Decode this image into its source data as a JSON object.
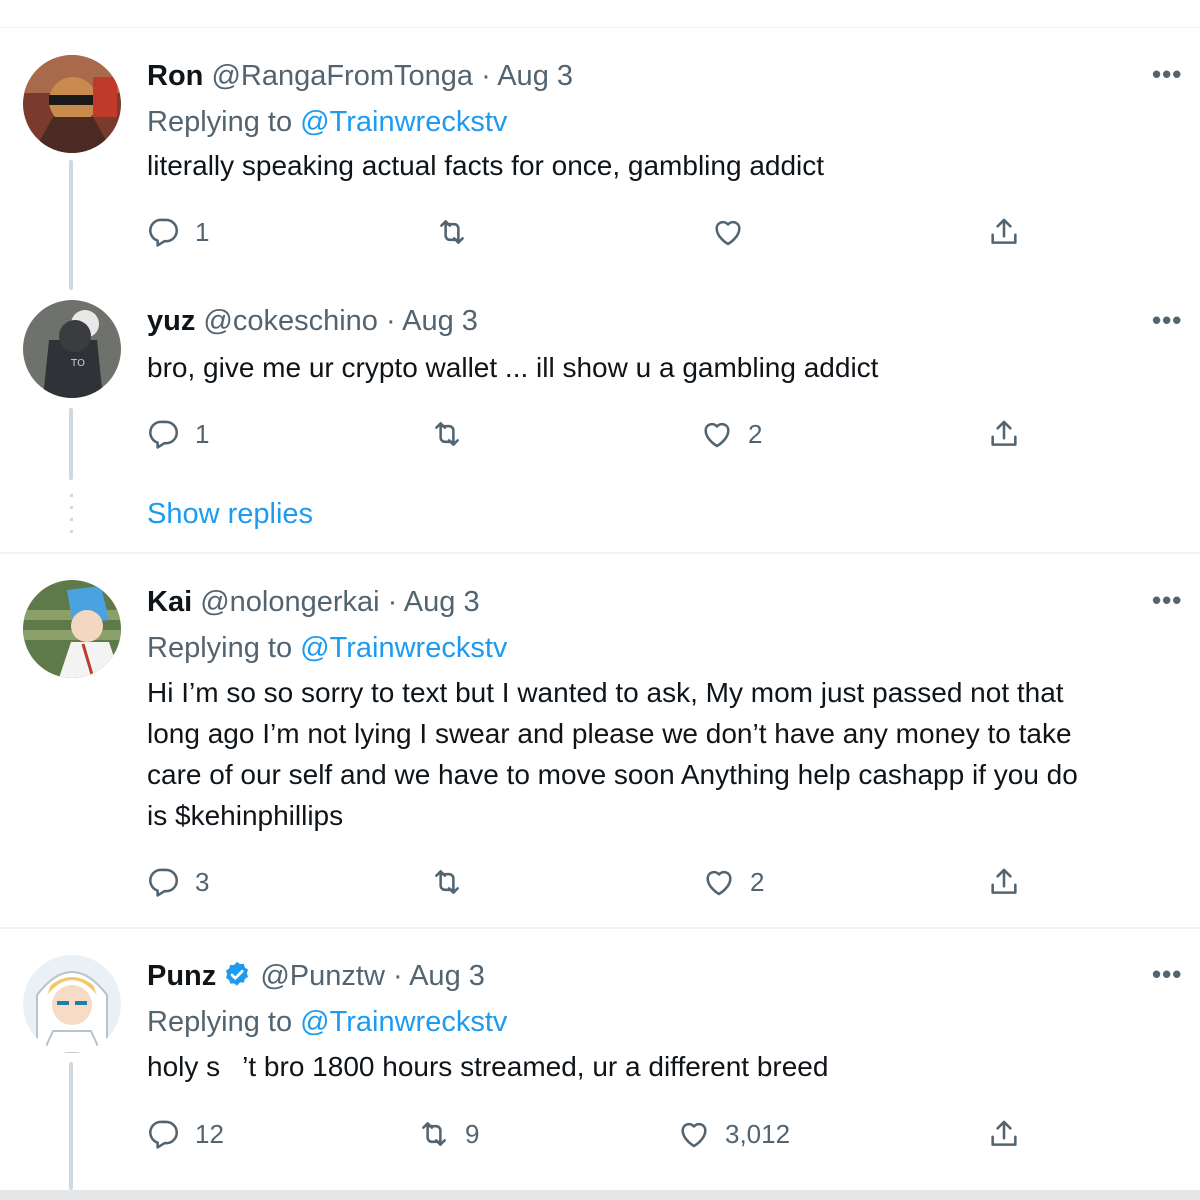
{
  "tweets": [
    {
      "name": "Ron",
      "handle": "@RangaFromTonga",
      "sep": "·",
      "date": "Aug 3",
      "replying_prefix": "Replying to",
      "replying_to": "@Trainwreckstv",
      "text": "literally speaking actual facts for once, gambling addict",
      "replies": "1",
      "retweets": "",
      "likes": ""
    },
    {
      "name": "yuz",
      "handle": "@cokeschino",
      "sep": "·",
      "date": "Aug 3",
      "text": "bro, give me ur crypto wallet ... ill show u a gambling addict",
      "replies": "1",
      "retweets": "",
      "likes": "2"
    },
    {
      "name": "Kai",
      "handle": "@nolongerkai",
      "sep": "·",
      "date": "Aug 3",
      "replying_prefix": "Replying to",
      "replying_to": "@Trainwreckstv",
      "text_lines": [
        "Hi I’m so so sorry to text but I wanted to ask, My mom just passed not that",
        "long ago I’m not lying I swear and please we don’t have any money to take",
        "care of our self and we have to move soon Anything help cashapp if you do",
        "is $kehinphillips"
      ],
      "replies": "3",
      "retweets": "",
      "likes": "2"
    },
    {
      "name": "Punz",
      "handle": "@Punztw",
      "sep": "·",
      "date": "Aug 3",
      "replying_prefix": "Replying to",
      "replying_to": "@Trainwreckstv",
      "text_start": "holy s",
      "text_end": "’t bro 1800 hours streamed, ur a different breed",
      "replies": "12",
      "retweets": "9",
      "likes": "3,012"
    }
  ],
  "show_replies": "Show replies",
  "more_glyph": "•••",
  "icons": [
    "reply-icon",
    "retweet-icon",
    "like-icon",
    "share-icon",
    "more-icon",
    "verified-badge-icon"
  ],
  "colors": {
    "accent": "#1d9bf0",
    "muted": "#536471",
    "text": "#0f1419",
    "divider": "#eff3f4",
    "thread": "#cfd9de"
  }
}
